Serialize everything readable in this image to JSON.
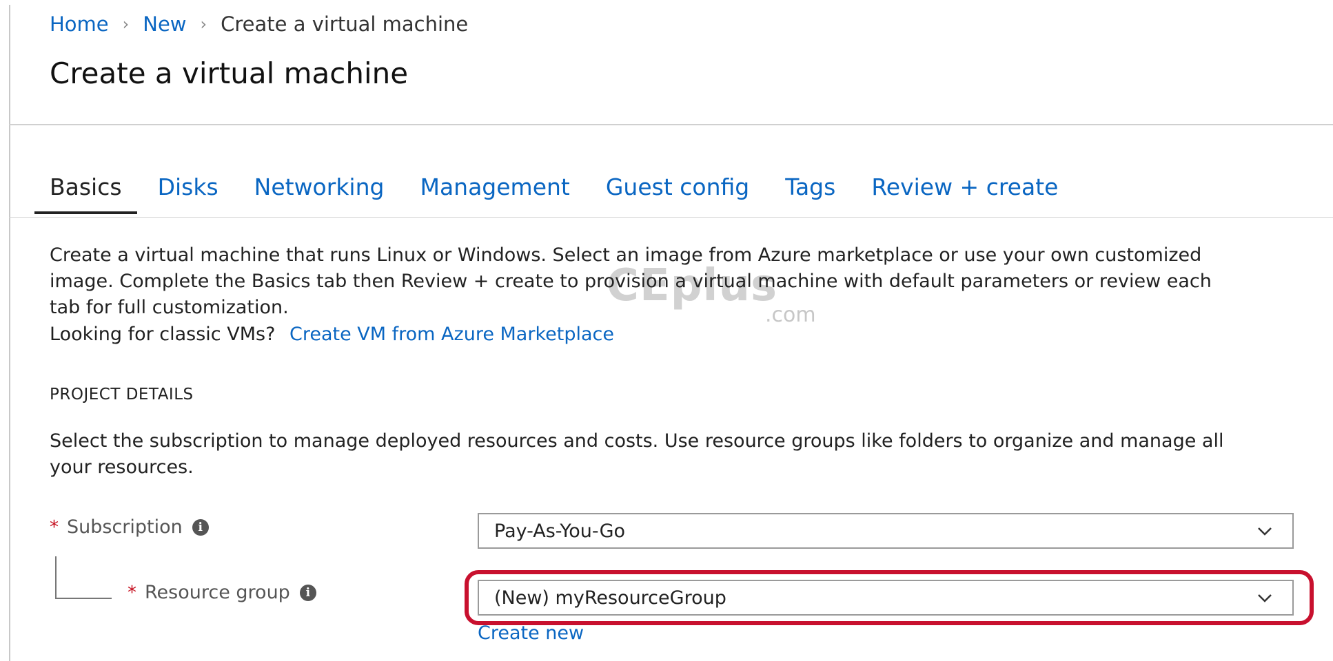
{
  "breadcrumb": {
    "items": [
      "Home",
      "New",
      "Create a virtual machine"
    ]
  },
  "page": {
    "title": "Create a virtual machine"
  },
  "tabs": [
    {
      "label": "Basics",
      "active": true
    },
    {
      "label": "Disks",
      "active": false
    },
    {
      "label": "Networking",
      "active": false
    },
    {
      "label": "Management",
      "active": false
    },
    {
      "label": "Guest config",
      "active": false
    },
    {
      "label": "Tags",
      "active": false
    },
    {
      "label": "Review + create",
      "active": false
    }
  ],
  "intro": {
    "description": "Create a virtual machine that runs Linux or Windows. Select an image from Azure marketplace or use your own customized image. Complete the Basics tab then Review + create to provision a virtual machine with default parameters or review each tab for full customization.",
    "classic_prompt": "Looking for classic VMs?",
    "classic_link": "Create VM from Azure Marketplace"
  },
  "project_details": {
    "heading": "PROJECT DETAILS",
    "description": "Select the subscription to manage deployed resources and costs. Use resource groups like folders to organize and manage all your resources.",
    "subscription": {
      "label": "Subscription",
      "required_mark": "*",
      "value": "Pay-As-You-Go"
    },
    "resource_group": {
      "label": "Resource group",
      "required_mark": "*",
      "value": "(New) myResourceGroup",
      "create_new": "Create new"
    }
  },
  "watermark": {
    "text": "CEplus",
    "suffix": ".com"
  },
  "colors": {
    "link": "#0a66c2",
    "required": "#c50f1f",
    "highlight": "#c8102e"
  }
}
